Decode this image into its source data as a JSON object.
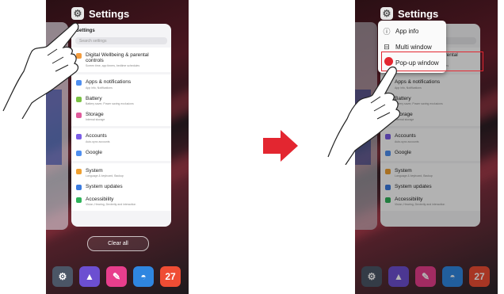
{
  "left_screen": {
    "header_title": "Settings",
    "card_title": "Settings",
    "search_placeholder": "Search settings",
    "items": [
      {
        "label": "Digital Wellbeing & parental controls",
        "sub": "Screen time, app timers, bedtime schedules",
        "color": "#f39c3d"
      },
      {
        "label": "Apps & notifications",
        "sub": "App info, Notifications",
        "color": "#4f8ff0"
      },
      {
        "label": "Battery",
        "sub": "Battery saver, Power saving exclusions",
        "color": "#7ac143"
      },
      {
        "label": "Storage",
        "sub": "Internal storage",
        "color": "#e05a9b"
      },
      {
        "label": "Accounts",
        "sub": "Auto-sync accounts",
        "color": "#7a5ce6"
      },
      {
        "label": "Google",
        "sub": "",
        "color": "#4f8ff0"
      },
      {
        "label": "System",
        "sub": "Language & keyboard, Backup",
        "color": "#f0a030"
      },
      {
        "label": "System updates",
        "sub": "",
        "color": "#3a7be0"
      },
      {
        "label": "Accessibility",
        "sub": "Vision, Hearing, Dexterity and interaction",
        "color": "#2fb35a"
      }
    ],
    "clear_all": "Clear all",
    "dock": [
      {
        "icon": "gear-icon",
        "glyph": "⚙",
        "color": "#4b5666"
      },
      {
        "icon": "mountain-icon",
        "glyph": "▲",
        "color": "#6c4fd1"
      },
      {
        "icon": "pen-icon",
        "glyph": "✎",
        "color": "#e83e8c"
      },
      {
        "icon": "browser-icon",
        "glyph": "◓",
        "color": "#2f86e0"
      },
      {
        "icon": "calendar-icon",
        "glyph": "27",
        "color": "#ef4d34"
      }
    ]
  },
  "right_screen": {
    "header_title": "Settings",
    "menu": [
      {
        "label": "App info",
        "glyph": "ⓘ"
      },
      {
        "label": "Multi window",
        "glyph": "⊟"
      },
      {
        "label": "Pop-up window",
        "glyph": ""
      }
    ]
  },
  "colors": {
    "highlight": "#e32630",
    "arrow": "#e32630"
  }
}
